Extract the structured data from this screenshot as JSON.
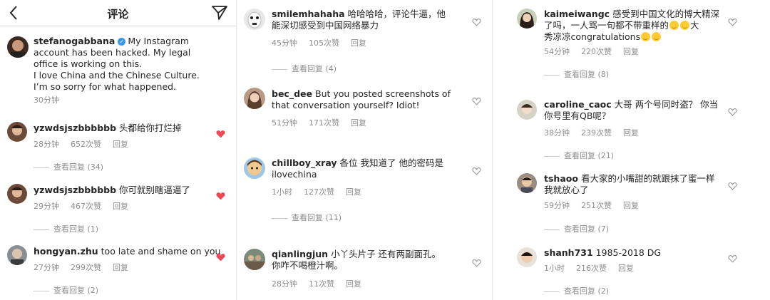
{
  "header": {
    "title": "评论"
  },
  "post": {
    "username": "stefanogabbana",
    "caption": [
      "My Instagram",
      "account has been hacked. My legal",
      "office is working on this.",
      "I love China and the Chinese Culture.",
      "I’m so sorry for what happened."
    ],
    "time": "30分钟"
  },
  "column1": [
    {
      "username": "yzwdsjszbbbbbb",
      "text": "头都给你打烂掉",
      "time": "28分钟",
      "likes": "652次赞",
      "reply": "回复",
      "view_replies": "查看回复 (34)"
    },
    {
      "username": "yzwdsjszbbbbbb",
      "text": "你可就别瞎逼逼了",
      "time": "29分钟",
      "likes": "467次赞",
      "reply": "回复",
      "view_replies": "查看回复 (1)"
    },
    {
      "username": "hongyan.zhu",
      "text": "too late and shame on you",
      "time": "27分钟",
      "likes": "299次赞",
      "reply": "回复",
      "view_replies": "查看回复 (2)"
    }
  ],
  "column2": [
    {
      "username": "smilemhahaha",
      "line1": "哈哈哈哈，评论牛逼，他",
      "line2": "能深切感受到中国网络暴力",
      "time": "45分钟",
      "likes": "105次赞",
      "reply": "回复",
      "view_replies": "查看回复 (4)"
    },
    {
      "username": "bec_dee",
      "line1": "But you posted screenshots of",
      "line2": "that conversation yourself? Idiot!",
      "time": "51分钟",
      "likes": "171次赞",
      "reply": "回复"
    },
    {
      "username": "chillboy_xray",
      "line1": "各位 我知道了 他的密码是",
      "line2": "ilovechina",
      "time": "1小时",
      "likes": "127次赞",
      "reply": "回复",
      "view_replies": "查看回复 (11)"
    },
    {
      "username": "qianlingjun",
      "line1": "小丫头片子 还有两副面孔。",
      "line2": "你咋不喝橙汁啊。",
      "time": "28分钟",
      "likes": "11次赞",
      "reply": "回复"
    }
  ],
  "column3": [
    {
      "username": "kaimeiwangc",
      "line1": "感受到中国文化的博大精深",
      "line2": "了吗，一人骂一句都不带重样的",
      "line3a": "大",
      "line3b": "秀凉凉congratulations",
      "time": "54分钟",
      "likes": "220次赞",
      "reply": "回复",
      "view_replies": "查看回复 (8)"
    },
    {
      "username": "caroline_caoc",
      "line1": "大哥 两个号同时盗？ 你当",
      "line2": "你号里有QB呢？",
      "time": "38分钟",
      "likes": "239次赞",
      "reply": "回复",
      "view_replies": "查看回复 (21)"
    },
    {
      "username": "tshaoo",
      "line1": "看大家的小嘴甜的就跟抹了蜜一样",
      "line2": "我就放心了",
      "time": "59分钟",
      "likes": "251次赞",
      "reply": "回复",
      "view_replies": "查看回复 (7)"
    },
    {
      "username": "shanh731",
      "line1": "1985-2018 DG",
      "time": "1小时",
      "likes": "216次赞",
      "reply": "回复",
      "view_replies": "查看回复 (2)"
    }
  ],
  "colors": {
    "heart_red": "#ed4956",
    "meta_gray": "#8e8e8e",
    "text": "#262626",
    "verified_blue": "#3897f0"
  }
}
